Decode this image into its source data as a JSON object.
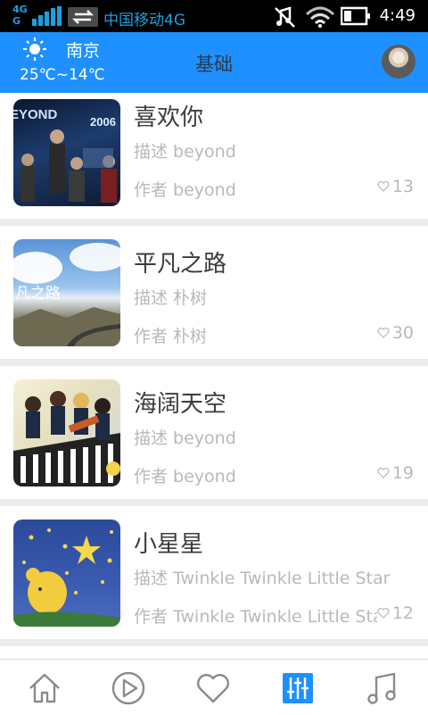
{
  "status_bar": {
    "network_top": "4G",
    "network_bottom": "G",
    "carrier": "中国移动4G",
    "time": "4:49",
    "icons": [
      "signal-icon",
      "data-swap-icon",
      "mute-icon",
      "wifi-icon",
      "battery-icon"
    ]
  },
  "header": {
    "weather_icon": "sun-icon",
    "city": "南京",
    "temperature": "25℃~14℃",
    "title": "基础"
  },
  "songs": [
    {
      "title": "喜欢你",
      "desc": "描述 beyond",
      "author": "作者 beyond",
      "likes": "13",
      "art_text": "EYOND",
      "art_year": "2006"
    },
    {
      "title": "平凡之路",
      "desc": "描述 朴树",
      "author": "作者 朴树",
      "likes": "30",
      "art_text": "凡之路"
    },
    {
      "title": "海阔天空",
      "desc": "描述 beyond",
      "author": "作者 beyond",
      "likes": "19"
    },
    {
      "title": "小星星",
      "desc": "描述 Twinkle Twinkle Little Star",
      "author": "作者 Twinkle Twinkle Little Star",
      "likes": "12"
    }
  ],
  "tabs": [
    {
      "icon": "home-icon",
      "active": false
    },
    {
      "icon": "play-icon",
      "active": false
    },
    {
      "icon": "heart-icon",
      "active": false
    },
    {
      "icon": "equalizer-icon",
      "active": true
    },
    {
      "icon": "music-note-icon",
      "active": false
    }
  ],
  "colors": {
    "accent": "#1e90ff",
    "header_title": "#2d3a4a",
    "inactive_tab": "#8a8a8a"
  }
}
